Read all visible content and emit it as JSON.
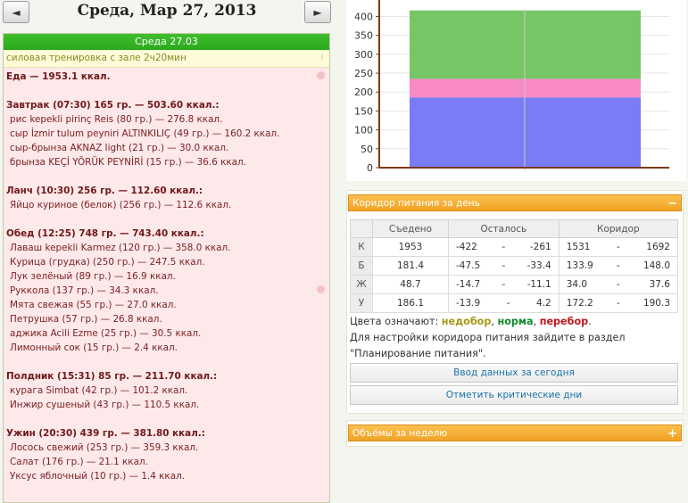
{
  "header": {
    "prev_label": "◄",
    "next_label": "►",
    "date_title": "Среда, Мар 27, 2013"
  },
  "day": {
    "header": "Среда 27.03",
    "training": "силовая тренировка с зале 2ч20мин",
    "training_mark": "!",
    "lines": [
      {
        "type": "total",
        "text": "Еда — 1953.1 ккал."
      },
      {
        "type": "spacer",
        "text": ""
      },
      {
        "type": "meal",
        "text": "Завтрак (07:30) 165 гр. — 503.60 ккал.:"
      },
      {
        "type": "food",
        "text": "рис kepekli pirinç Reis (80 гр.) — 276.8 ккал."
      },
      {
        "type": "food",
        "text": "сыр İzmir tulum peyniri ALTINKILIÇ (49 гр.) — 160.2 ккал."
      },
      {
        "type": "food",
        "text": "сыр-брынза AKNAZ light (21 гр.) — 30.0 ккал."
      },
      {
        "type": "food",
        "text": "брынза KEÇİ YÖRÜK PEYNİRİ (15 гр.) — 36.6 ккал."
      },
      {
        "type": "spacer",
        "text": ""
      },
      {
        "type": "meal",
        "text": "Ланч (10:30) 256 гр. — 112.60 ккал.:"
      },
      {
        "type": "food",
        "text": "Яйцо куриное (белок) (256 гр.) — 112.6 ккал."
      },
      {
        "type": "spacer",
        "text": ""
      },
      {
        "type": "meal",
        "text": "Обед (12:25) 748 гр. — 743.40 ккал.:"
      },
      {
        "type": "food",
        "text": "Лаваш kepekli Karmez (120 гр.) — 358.0 ккал."
      },
      {
        "type": "food",
        "text": "Курица (грудка) (250 гр.) — 247.5 ккал."
      },
      {
        "type": "food",
        "text": "Лук зелёный (89 гр.) — 16.9 ккал."
      },
      {
        "type": "food",
        "text": "Руккола (137 гр.) — 34.3 ккал."
      },
      {
        "type": "food",
        "text": "Мята свежая (55 гр.) — 27.0 ккал."
      },
      {
        "type": "food",
        "text": "Петрушка (57 гр.) — 26.8 ккал."
      },
      {
        "type": "food",
        "text": "аджика Acili Ezme (25 гр.) — 30.5 ккал."
      },
      {
        "type": "food",
        "text": "Лимонный сок (15 гр.) — 2.4 ккал."
      },
      {
        "type": "spacer",
        "text": ""
      },
      {
        "type": "meal",
        "text": "Полдник (15:31) 85 гр. — 211.70 ккал.:"
      },
      {
        "type": "food",
        "text": "курага Simbat (42 гр.) — 101.2 ккал."
      },
      {
        "type": "food",
        "text": "Инжир сушеный (43 гр.) — 110.5 ккал."
      },
      {
        "type": "spacer",
        "text": ""
      },
      {
        "type": "meal",
        "text": "Ужин (20:30) 439 гр. — 381.80 ккал.:"
      },
      {
        "type": "food",
        "text": "Лосось свежий (253 гр.) — 359.3 ккал."
      },
      {
        "type": "food",
        "text": "Салат (176 гр.) — 21.1 ккал."
      },
      {
        "type": "food",
        "text": "Уксус яблочный (10 гр.) — 1.4 ккал."
      }
    ]
  },
  "chart_data": {
    "type": "bar",
    "title": "",
    "xlabel": "",
    "ylabel": "",
    "ylim": [
      0,
      420
    ],
    "yticks": [
      0,
      50,
      100,
      150,
      200,
      250,
      300,
      350,
      400
    ],
    "stacked": true,
    "categories": [
      ""
    ],
    "series": [
      {
        "values": [
          186
        ],
        "color": "#7a7cf5"
      },
      {
        "values": [
          49
        ],
        "color": "#f88ac4"
      },
      {
        "values": [
          181
        ],
        "color": "#76c665"
      }
    ]
  },
  "corridor": {
    "title": "Коридор питания за день",
    "toggle": "−",
    "headers": [
      "",
      "Съедено",
      "Осталось",
      "Коридор"
    ],
    "rows": [
      {
        "label": "К",
        "eaten": "1953",
        "eaten_status": "over",
        "rem_min": "-422",
        "rem_max": "-261",
        "cor_min": "1531",
        "cor_max": "1692"
      },
      {
        "label": "Б",
        "eaten": "181.4",
        "eaten_status": "over",
        "rem_min": "-47.5",
        "rem_max": "-33.4",
        "cor_min": "133.9",
        "cor_max": "148.0"
      },
      {
        "label": "Ж",
        "eaten": "48.7",
        "eaten_status": "over",
        "rem_min": "-14.7",
        "rem_max": "-11.1",
        "cor_min": "34.0",
        "cor_max": "37.6"
      },
      {
        "label": "У",
        "eaten": "186.1",
        "eaten_status": "norm",
        "rem_min": "-13.9",
        "rem_max": "4.2",
        "cor_min": "172.2",
        "cor_max": "190.3"
      }
    ],
    "dash": "-",
    "legend_prefix": "Цвета означают:",
    "legend_under": "недобор",
    "legend_norm": "норма",
    "legend_over": "перебор",
    "legend_suffix": ".",
    "settings_line1": "Для настройки коридора питания зайдите в раздел",
    "settings_line2": "\"Планирование питания\".",
    "btn_enter": "Ввод данных за сегодня",
    "btn_critical": "Отметить критические дни"
  },
  "volume": {
    "title": "Объёмы за неделю",
    "toggle": "+"
  },
  "colors": {
    "over": "#b0151a",
    "norm": "#1d8a1d",
    "accent": "#f0a224"
  }
}
